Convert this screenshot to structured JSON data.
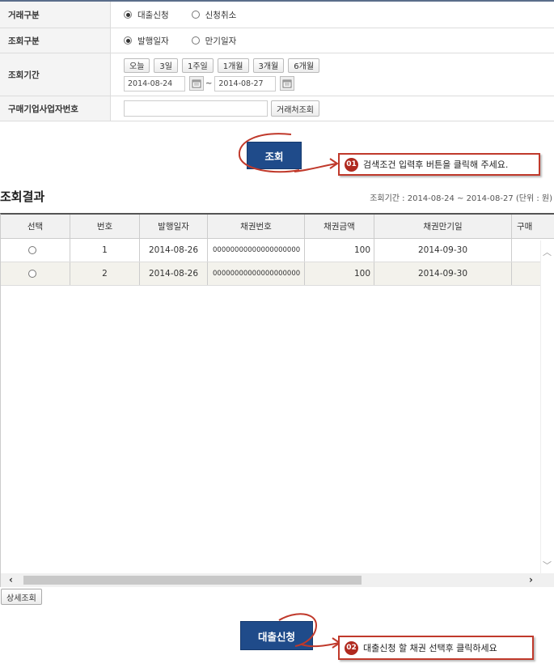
{
  "form": {
    "trade_type": {
      "label": "거래구분",
      "options": [
        "대출신청",
        "신청취소"
      ],
      "selected": 0
    },
    "query_type": {
      "label": "조회구분",
      "options": [
        "발행일자",
        "만기일자"
      ],
      "selected": 0
    },
    "period": {
      "label": "조회기간",
      "buttons": [
        "오늘",
        "3일",
        "1주일",
        "1개월",
        "3개월",
        "6개월"
      ],
      "start_date": "2014-08-24",
      "end_date": "2014-08-27",
      "separator": "~"
    },
    "biz_number": {
      "label": "구매기업사업자번호",
      "value": "",
      "lookup_label": "거래처조회"
    }
  },
  "search_button": "조회",
  "callout1": {
    "badge": "01",
    "text": "검색조건 입력후 버튼을 클릭해 주세요."
  },
  "result": {
    "title": "조회결과",
    "meta": "조회기간 : 2014-08-24 ~ 2014-08-27 (단위 : 원)",
    "columns": [
      "선택",
      "번호",
      "발행일자",
      "채권번호",
      "채권금액",
      "채권만기일",
      "구매"
    ],
    "rows": [
      {
        "no": "1",
        "issue_date": "2014-08-26",
        "bond_no": "00000000000000000000",
        "amount": "100",
        "due_date": "2014-09-30"
      },
      {
        "no": "2",
        "issue_date": "2014-08-26",
        "bond_no": "00000000000000000000",
        "amount": "100",
        "due_date": "2014-09-30"
      }
    ]
  },
  "detail_button": "상세조회",
  "loan_button": "대출신청",
  "callout2": {
    "badge": "02",
    "text": "대출신청 할 채권 선택후 클릭하세요"
  },
  "icons": {
    "calendar": "calendar-icon",
    "radio": "radio-icon"
  },
  "colors": {
    "primary": "#1f4b8a",
    "callout_border": "#c0392b",
    "badge": "#b02a1f"
  }
}
